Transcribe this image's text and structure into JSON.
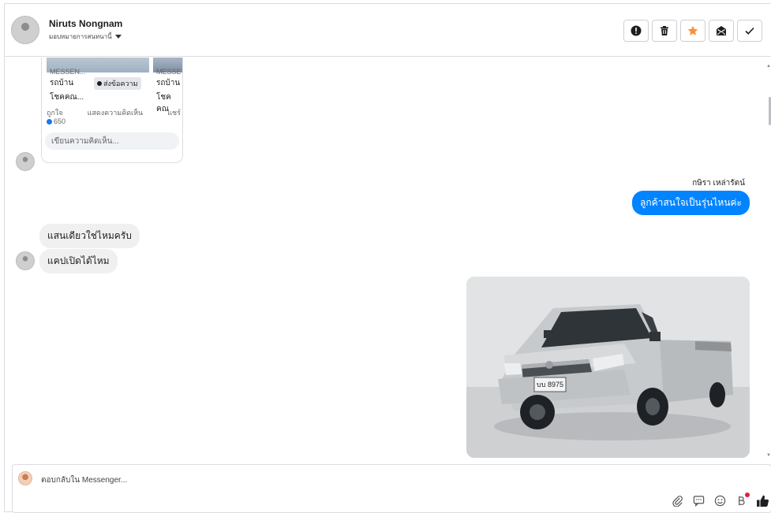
{
  "header": {
    "contact_name": "Niruts Nongnam",
    "assign_label": "มอบหมายการสนทนานี้",
    "actions": [
      {
        "name": "mark-spam-button",
        "icon": "exclamation-icon"
      },
      {
        "name": "delete-button",
        "icon": "trash-icon"
      },
      {
        "name": "star-button",
        "icon": "star-icon"
      },
      {
        "name": "mark-unread-button",
        "icon": "envelope-icon"
      },
      {
        "name": "mark-done-button",
        "icon": "check-icon"
      }
    ],
    "star_color": "#f7923b"
  },
  "post_card": {
    "caption_a_source": "MESSEN...",
    "caption_b_source": "MESSE",
    "caption_a_title": "รถบ้าน",
    "caption_b_title": "รถบ้าน",
    "caption_a_sub": "โชคคณ...",
    "caption_b_sub": "โชคคณ",
    "send_message": "ส่งข้อความ",
    "like": "ถูกใจ",
    "comment": "แสดงความคิดเห็น",
    "share": "แชร์",
    "like_count": "650",
    "comment_placeholder": "เขียนความคิดเห็น..."
  },
  "messages": {
    "sender_name": "กษิรา เหล่ารัตน์",
    "outgoing_1": "ลูกค้าสนใจเป็นรุ่นไหนค่ะ",
    "incoming_1": "แสนเดียวใช่ไหมครับ",
    "incoming_2": "แคปเปิดได้ไหม",
    "photo_plate": "บบ 8975"
  },
  "composer": {
    "placeholder": "ตอบกลับใน Messenger...",
    "tools": [
      "attachment-icon",
      "saved-reply-icon",
      "emoji-icon",
      "payment-icon",
      "like-icon"
    ]
  },
  "colors": {
    "accent": "#0084ff",
    "incoming_bubble": "#f0f0f0"
  }
}
